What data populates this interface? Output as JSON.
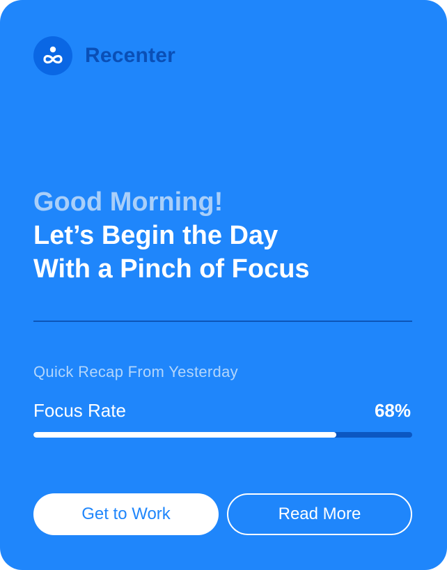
{
  "app": {
    "name": "Recenter",
    "logo_icon": "infinity-person-icon"
  },
  "headline": {
    "greeting": "Good Morning!",
    "line1": "Let’s Begin the Day",
    "line2": "With a Pinch of Focus"
  },
  "recap": {
    "caption": "Quick Recap From Yesterday",
    "metric_label": "Focus Rate",
    "metric_value": "68%",
    "progress_fraction": 0.8
  },
  "actions": {
    "primary_label": "Get to Work",
    "secondary_label": "Read More"
  },
  "colors": {
    "card_background": "#1f86fb",
    "brand_text": "#0a4fb6",
    "greeting_text": "#a9cff9",
    "progress_track": "#0b57c2",
    "progress_fill": "#ffffff"
  }
}
